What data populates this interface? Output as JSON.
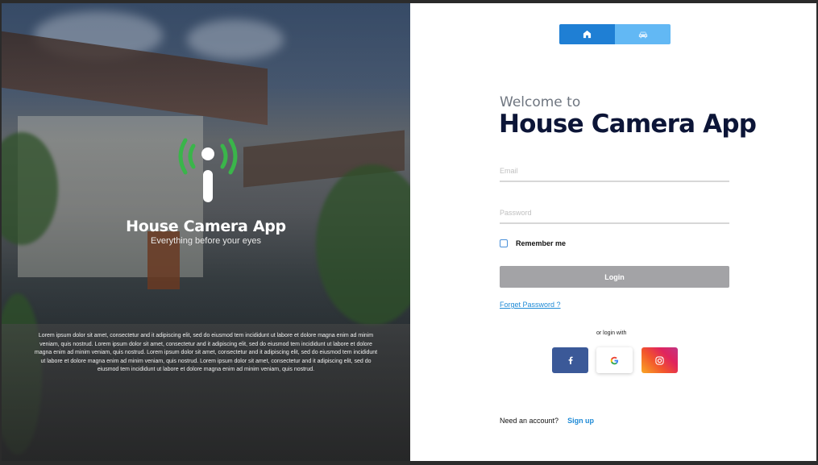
{
  "hero": {
    "title": "House Camera App",
    "subtitle": "Everything before your eyes",
    "body": "Lorem ipsum dolor sit amet, consectetur and it adipiscing elit, sed do eiusmod tem incididunt ut labore et dolore magna  enim ad minim veniam, quis nostrud. Lorem ipsum dolor sit amet, consectetur and it adipiscing elit, sed do eiusmod tem incididunt ut labore et dolore magna  enim ad minim veniam, quis nostrud. Lorem ipsum dolor sit amet, consectetur and it adipiscing elit, sed do eiusmod tem incididunt ut labore et dolore magna  enim ad minim veniam, quis nostrud. Lorem ipsum dolor sit amet, consectetur and it adipiscing elit, sed do eiusmod tem incididunt ut labore et dolore magna  enim ad minim veniam, quis nostrud.",
    "logo_icon": "camera-signal-icon",
    "logo_color": "#3ab54a"
  },
  "toggle": {
    "options": [
      {
        "icon": "house-icon",
        "active": true
      },
      {
        "icon": "car-icon",
        "active": false
      }
    ],
    "active_color": "#1f7fd4",
    "inactive_color": "#62b8f4"
  },
  "login": {
    "welcome": "Welcome to",
    "title": "House Camera App",
    "email_placeholder": "Email",
    "password_placeholder": "Password",
    "remember_label": "Remember me",
    "login_label": "Login",
    "forget_label": "Forget Password ?",
    "or_login_with": "or login with",
    "social": [
      "facebook-icon",
      "google-icon",
      "instagram-icon"
    ],
    "need_account": "Need an account?",
    "signup_label": "Sign up",
    "link_color": "#1e8ad6",
    "title_color": "#0c1537"
  }
}
